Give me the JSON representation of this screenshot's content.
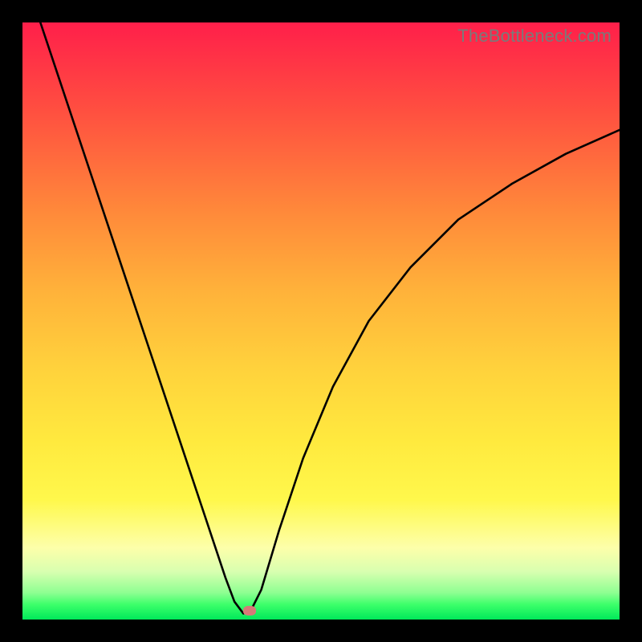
{
  "watermark": "TheBottleneck.com",
  "chart_data": {
    "type": "line",
    "title": "",
    "xlabel": "",
    "ylabel": "",
    "xlim": [
      0,
      100
    ],
    "ylim": [
      0,
      100
    ],
    "grid": false,
    "legend": false,
    "notes": "V-shaped bottleneck curve over red→yellow→green vertical gradient. Axes/ticks not shown; values are estimated from pixel positions. y decreases toward the green band (better). Minimum near x≈37 at y≈1.",
    "series": [
      {
        "name": "curve",
        "color": "#000000",
        "x": [
          3,
          6,
          9,
          12,
          15,
          18,
          21,
          24,
          27,
          30,
          32,
          34,
          35.5,
          37,
          38.5,
          40,
          43,
          47,
          52,
          58,
          65,
          73,
          82,
          91,
          100
        ],
        "y": [
          100,
          91,
          82,
          73,
          64,
          55,
          46,
          37,
          28,
          19,
          13,
          7,
          3,
          1,
          2,
          5,
          15,
          27,
          39,
          50,
          59,
          67,
          73,
          78,
          82
        ]
      }
    ],
    "marker": {
      "x": 38,
      "y": 1.5,
      "color": "#d67a78"
    },
    "gradient_stops": [
      {
        "pos": 0.0,
        "color": "#ff1f4a"
      },
      {
        "pos": 0.15,
        "color": "#ff5040"
      },
      {
        "pos": 0.32,
        "color": "#ff8a3a"
      },
      {
        "pos": 0.45,
        "color": "#ffb23a"
      },
      {
        "pos": 0.58,
        "color": "#ffd23c"
      },
      {
        "pos": 0.7,
        "color": "#ffe93e"
      },
      {
        "pos": 0.8,
        "color": "#fff84c"
      },
      {
        "pos": 0.88,
        "color": "#fdffaa"
      },
      {
        "pos": 0.92,
        "color": "#d8ffb0"
      },
      {
        "pos": 0.955,
        "color": "#8eff92"
      },
      {
        "pos": 0.975,
        "color": "#3cff6a"
      },
      {
        "pos": 1.0,
        "color": "#00e85a"
      }
    ]
  }
}
